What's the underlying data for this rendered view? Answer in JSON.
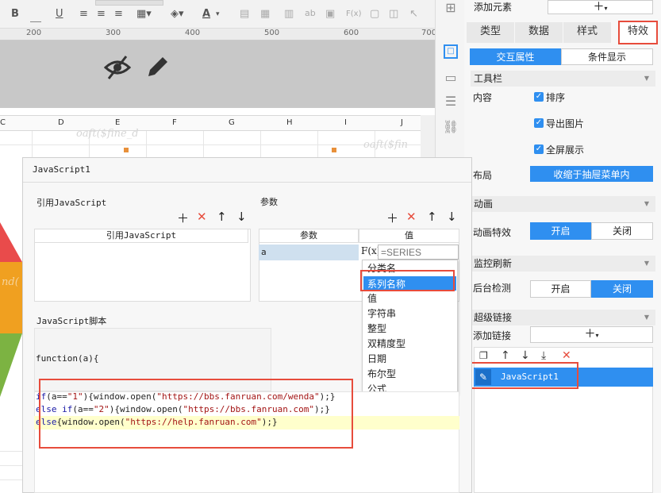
{
  "toolbar": {
    "bold": "B",
    "underline": "U",
    "font_color": "A",
    "fx": "F(x)",
    "ab": "ab"
  },
  "ruler": {
    "marks": [
      "200",
      "300",
      "400",
      "500",
      "600",
      "700"
    ]
  },
  "columns": [
    "C",
    "D",
    "E",
    "F",
    "G",
    "H",
    "I",
    "J"
  ],
  "watermarks": [
    "oaft($fine_d",
    "oaft($fin",
    "nd("
  ],
  "right_panel": {
    "add_element": "添加元素",
    "tabs": [
      "类型",
      "数据",
      "样式",
      "特效"
    ],
    "subtabs": [
      "交互属性",
      "条件显示"
    ],
    "toolbar_section": "工具栏",
    "content_label": "内容",
    "checks": [
      "排序",
      "导出图片",
      "全屏展示"
    ],
    "layout_label": "布局",
    "layout_value": "收缩于抽屉菜单内",
    "animation_section": "动画",
    "animation_label": "动画特效",
    "on": "开启",
    "off": "关闭",
    "refresh_section": "监控刷新",
    "backend_label": "后台检测",
    "hyperlink_section": "超级链接",
    "add_link_label": "添加链接",
    "link_item": "JavaScript1"
  },
  "dialog": {
    "title": "JavaScript1",
    "ref_js": "引用JavaScript",
    "params": "参数",
    "ref_js_header": "引用JavaScript",
    "param_header": "参数",
    "value_header": "值",
    "param_row_name": "a",
    "fx": "F(x)",
    "value_placeholder": "=SERIES",
    "script_label": "JavaScript脚本",
    "func_sig": "function(a){",
    "dropdown": [
      "分类名",
      "系列名称",
      "值",
      "字符串",
      "整型",
      "双精度型",
      "日期",
      "布尔型",
      "公式"
    ],
    "code": {
      "l1": {
        "kw": "if",
        "a": "(a==",
        "s1": "\"1\"",
        "b": "){window.open(",
        "s2": "\"https://bbs.fanruan.com/wenda\"",
        "c": ");}"
      },
      "l2": {
        "kw": "else if",
        "a": "(a==",
        "s1": "\"2\"",
        "b": "){window.open(",
        "s2": "\"https://bbs.fanruan.com\"",
        "c": ");}"
      },
      "l3": {
        "kw": "else",
        "b": "{window.open(",
        "s2": "\"https://help.fanruan.com\"",
        "c": ");}"
      }
    }
  },
  "colors": {
    "accent": "#2f8ff0",
    "highlight": "#e74c3c",
    "code_bg": "#ffffcc"
  },
  "icons": [
    "eye-slash-icon",
    "pencil-icon",
    "plus-icon",
    "close-icon",
    "arrow-up-icon",
    "arrow-down-icon",
    "copy-icon",
    "edit-icon"
  ]
}
